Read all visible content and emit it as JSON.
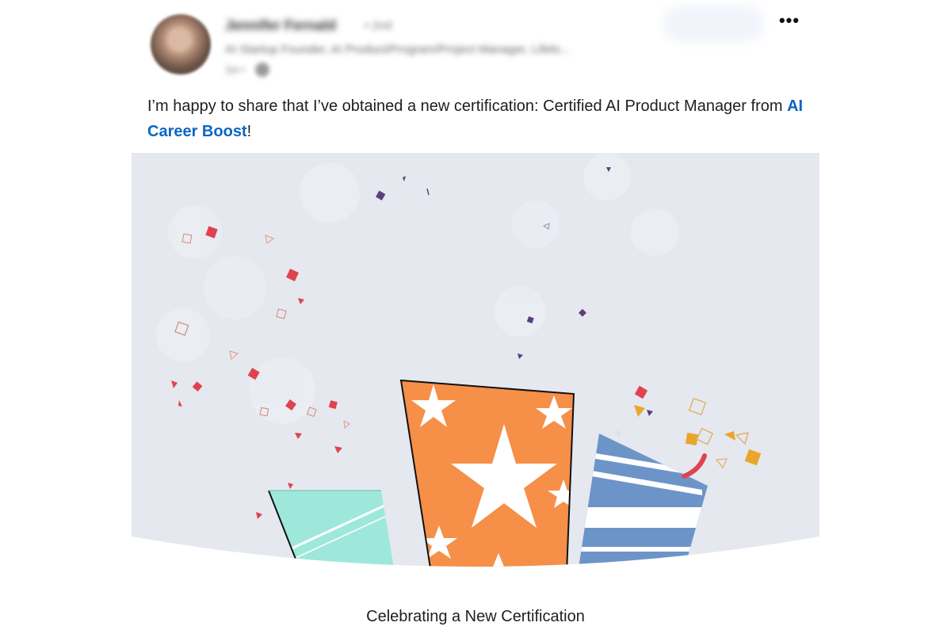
{
  "post": {
    "author": {
      "name": "Jennifer Fernald",
      "degree": "• 2nd",
      "headline": "AI Startup Founder, AI Product/Program/Project Manager, Lifelo...",
      "time": "1w •"
    },
    "more_label": "•••",
    "text_prefix": "I’m happy to share that I’ve obtained a new certification: Certified AI Product Manager from ",
    "link_text": "AI Career Boost",
    "text_suffix": "!"
  },
  "media": {
    "caption": "Celebrating a New Certification",
    "colors": {
      "background": "#e5e8ef",
      "orange_gift": "#f68f48",
      "blue_gift": "#6d94c8",
      "teal_gift": "#9ee8db",
      "confetti_red": "#e0434f",
      "confetti_gold": "#eaa52b",
      "confetti_purple": "#5b3f7f"
    },
    "icons": [
      "confetti",
      "gift-box-stars",
      "gift-box-stripes",
      "gift-box-teal",
      "ribbon-streamer"
    ]
  }
}
